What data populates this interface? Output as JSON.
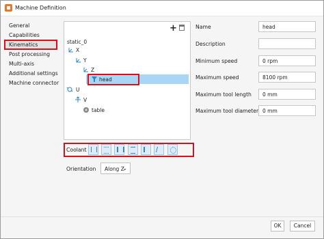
{
  "window": {
    "title": "Machine Definition"
  },
  "sidebar": {
    "items": [
      {
        "label": "General"
      },
      {
        "label": "Capabilities"
      },
      {
        "label": "Kinematics"
      },
      {
        "label": "Post processing"
      },
      {
        "label": "Multi-axis"
      },
      {
        "label": "Additional settings"
      },
      {
        "label": "Machine connector"
      }
    ]
  },
  "tree": {
    "nodes": [
      {
        "label": "static_0"
      },
      {
        "label": "X"
      },
      {
        "label": "Y"
      },
      {
        "label": "Z"
      },
      {
        "label": "head"
      },
      {
        "label": "U"
      },
      {
        "label": "V"
      },
      {
        "label": "table"
      }
    ]
  },
  "properties": {
    "name_label": "Name",
    "name_value": "head",
    "description_label": "Description",
    "description_value": "",
    "min_speed_label": "Minimum speed",
    "min_speed_value": "0 rpm",
    "max_speed_label": "Maximum speed",
    "max_speed_value": "8100 rpm",
    "max_tool_length_label": "Maximum tool length",
    "max_tool_length_value": "0 mm",
    "max_tool_diameter_label": "Maximum tool diameter",
    "max_tool_diameter_value": "0 mm"
  },
  "coolant": {
    "label": "Coolant",
    "options": [
      "flood",
      "mist",
      "through-tool",
      "air",
      "suction",
      "tool-air",
      "multiple"
    ]
  },
  "orientation": {
    "label": "Orientation",
    "value": "Along Z"
  },
  "buttons": {
    "ok": "OK",
    "cancel": "Cancel"
  }
}
